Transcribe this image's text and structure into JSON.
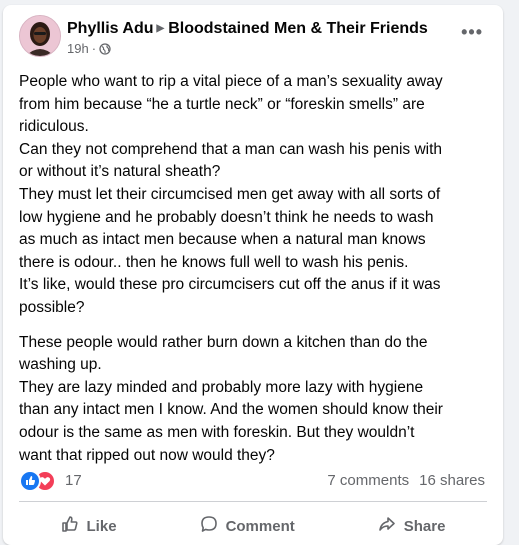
{
  "post": {
    "author": "Phyllis Adu",
    "group": "Bloodstained Men & Their Friends",
    "time": "19h",
    "paragraphs": [
      [
        "People who want to rip a vital piece of a man’s sexuality away",
        "from him because “he a turtle neck” or “foreskin smells” are",
        "ridiculous.",
        "Can they not comprehend that a man can wash his penis with",
        "or without it’s natural sheath?",
        "They must let their circumcised men get away with all sorts of",
        "low hygiene and he probably doesn’t think he needs to wash",
        "as much as intact men because when a natural man knows",
        "there is odour.. then he knows full well to wash his penis.",
        "It’s like, would these pro circumcisers cut off the anus if it was",
        "possible?"
      ],
      [
        "These people would rather burn down a kitchen than do the",
        "washing up.",
        "They are lazy minded and probably more lazy with hygiene",
        "than any intact men I know. And the women should know their",
        "odour is the same as men with foreskin. But they wouldn’t",
        "want that ripped out now would they?"
      ]
    ]
  },
  "reactions": {
    "count": "17",
    "comments": "7 comments",
    "shares": "16 shares"
  },
  "actions": {
    "like": "Like",
    "comment": "Comment",
    "share": "Share"
  },
  "colors": {
    "text": "#050505",
    "secondary": "#65676b",
    "like_blue": "#1877f2",
    "love_red": "#f33e58",
    "background": "#f0f2f5"
  },
  "icons": [
    "avatar",
    "chevron-right-icon",
    "globe-icon",
    "more-options-icon",
    "like-reaction-icon",
    "love-reaction-icon",
    "thumbs-up-icon",
    "comment-icon",
    "share-icon"
  ]
}
